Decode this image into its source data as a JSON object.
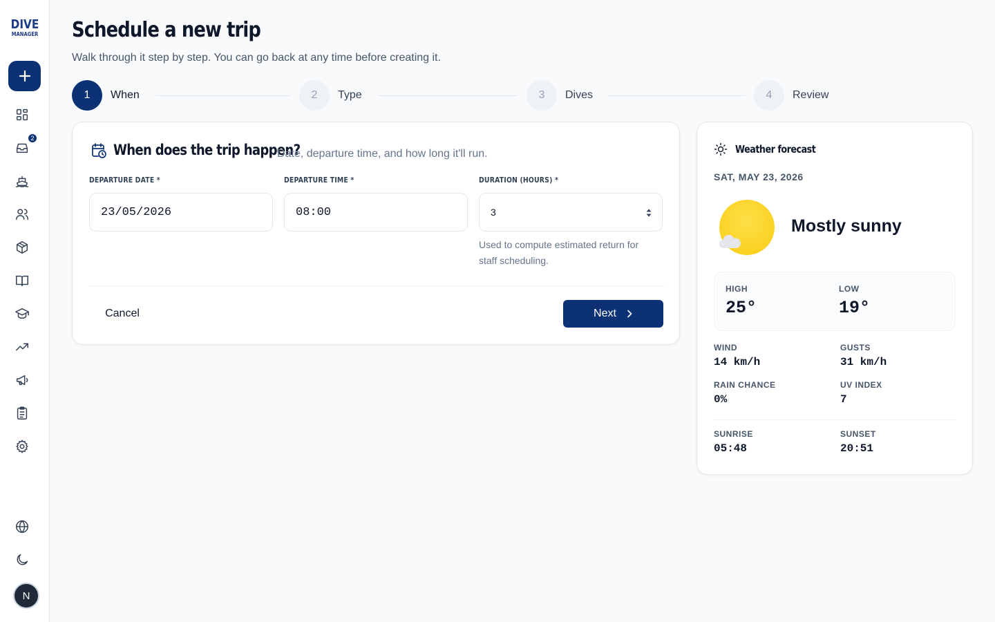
{
  "sidebar": {
    "logo_line1": "DIVE",
    "logo_line2": "MANAGER",
    "inbox_badge": "2",
    "avatar_initial": "N"
  },
  "header": {
    "title": "Schedule a new trip",
    "subtitle": "Walk through it step by step. You can go back at any time before creating it."
  },
  "stepper": {
    "steps": [
      {
        "num": "1",
        "label": "When"
      },
      {
        "num": "2",
        "label": "Type"
      },
      {
        "num": "3",
        "label": "Dives"
      },
      {
        "num": "4",
        "label": "Review"
      }
    ],
    "active_index": 0
  },
  "form": {
    "title": "When does the trip happen?",
    "description": "Date, departure time, and how long it'll run.",
    "fields": {
      "date_label": "DEPARTURE DATE *",
      "date_value": "23/05/2026",
      "time_label": "DEPARTURE TIME *",
      "time_value": "08:00",
      "duration_label": "DURATION (HOURS) *",
      "duration_value": "3",
      "duration_help": "Used to compute estimated return for staff scheduling."
    },
    "cancel_label": "Cancel",
    "next_label": "Next"
  },
  "weather": {
    "title": "Weather forecast",
    "date": "SAT, MAY 23, 2026",
    "condition": "Mostly sunny",
    "high_label": "HIGH",
    "high_value": "25°",
    "low_label": "LOW",
    "low_value": "19°",
    "wind_label": "WIND",
    "wind_value": "14 km/h",
    "gusts_label": "GUSTS",
    "gusts_value": "31 km/h",
    "rain_label": "RAIN CHANCE",
    "rain_value": "0%",
    "uv_label": "UV INDEX",
    "uv_value": "7",
    "sunrise_label": "SUNRISE",
    "sunrise_value": "05:48",
    "sunset_label": "SUNSET",
    "sunset_value": "20:51"
  },
  "colors": {
    "primary": "#0c3275",
    "sun": "#facc15"
  }
}
